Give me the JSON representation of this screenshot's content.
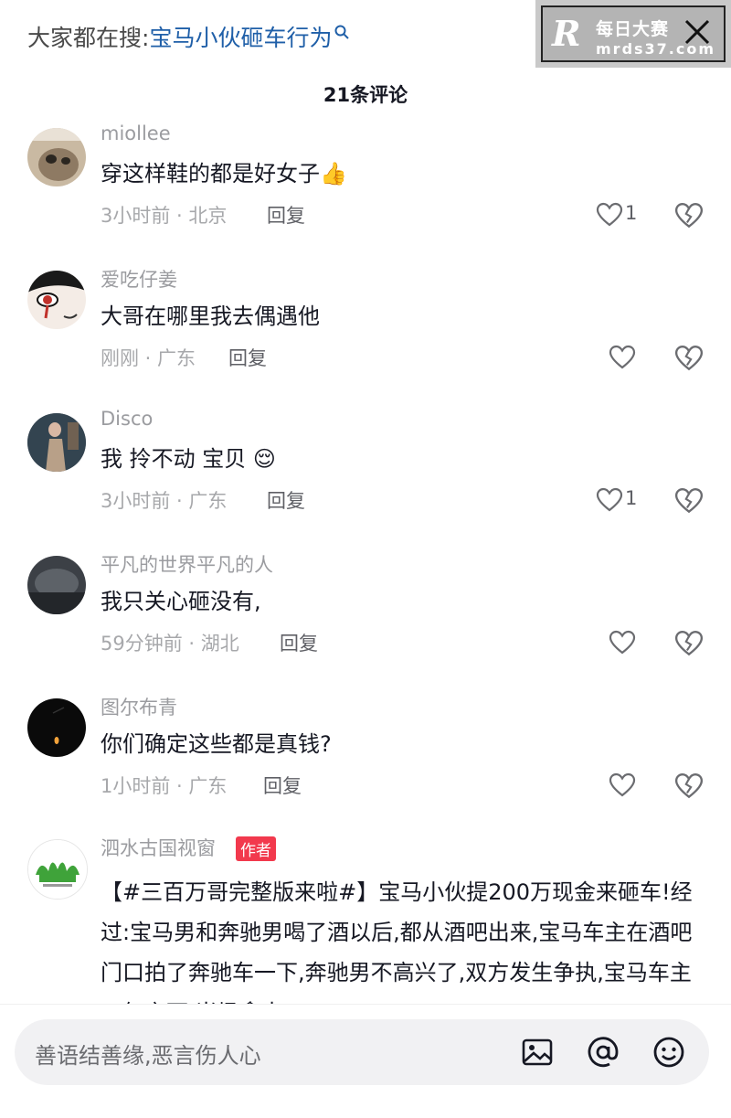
{
  "search_hint": {
    "prefix": "大家都在搜:",
    "keyword": "宝马小伙砸车行为"
  },
  "watermark": {
    "logo": "R",
    "title": "每日大赛",
    "url": "mrds37.com"
  },
  "comments_title": "21条评论",
  "comments": [
    {
      "user": "miollee",
      "text": "穿这样鞋的都是好女子",
      "emoji": "👍",
      "meta": "3小时前 · 北京",
      "reply": "回复",
      "likes": "1"
    },
    {
      "user": "爱吃仔姜",
      "text": "大哥在哪里我去偶遇他",
      "meta": "刚刚 · 广东",
      "reply": "回复",
      "likes": ""
    },
    {
      "user": "Disco",
      "text": "我 拎不动 宝贝",
      "emoji": "😌",
      "meta": "3小时前 · 广东",
      "reply": "回复",
      "likes": "1"
    },
    {
      "user": "平凡的世界平凡的人",
      "text": "我只关心砸没有,",
      "meta": "59分钟前 · 湖北",
      "reply": "回复",
      "likes": ""
    },
    {
      "user": "图尔布青",
      "text": "你们确定这些都是真钱?",
      "meta": "1小时前 · 广东",
      "reply": "回复",
      "likes": ""
    }
  ],
  "author_comment": {
    "user": "泗水古国视窗",
    "badge": "作者",
    "text": "【#三百万哥完整版来啦#】宝马小伙提200万现金来砸车!经过:宝马男和奔驰男喝了酒以后,都从酒吧出来,宝马车主在酒吧门口拍了奔驰车一下,奔驰男不高兴了,双方发生争执,宝马车主一气之下,当场拿出"
  },
  "input": {
    "placeholder": "善语结善缘,恶言伤人心"
  },
  "colors": {
    "link": "#1f5fa8",
    "badge": "#f2394d",
    "muted": "#a7a8ab"
  }
}
